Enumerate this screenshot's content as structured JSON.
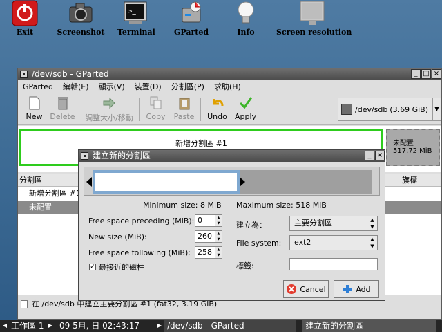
{
  "desktop": {
    "icons": [
      {
        "label": "Exit",
        "icon": "power-icon"
      },
      {
        "label": "Screenshot",
        "icon": "camera-icon"
      },
      {
        "label": "Terminal",
        "icon": "terminal-icon"
      },
      {
        "label": "GParted",
        "icon": "gparted-icon"
      },
      {
        "label": "Info",
        "icon": "lightbulb-icon"
      },
      {
        "label": "Screen resolution",
        "icon": "monitor-icon"
      }
    ]
  },
  "gparted": {
    "title": "/dev/sdb - GParted",
    "menu": [
      "GParted",
      "編輯(E)",
      "顯示(V)",
      "裝置(D)",
      "分割區(P)",
      "求助(H)"
    ],
    "toolbar": {
      "new": "New",
      "delete": "Delete",
      "resize": "調整大小/移動",
      "copy": "Copy",
      "paste": "Paste",
      "undo": "Undo",
      "apply": "Apply"
    },
    "device": {
      "name": "/dev/sdb",
      "size": "(3.69 GiB)"
    },
    "diskmap": {
      "new_partition": "新增分割區 #1",
      "unallocated_label": "未配置",
      "unallocated_size": "517.72 MiB"
    },
    "table": {
      "col_partition": "分割區",
      "col_flags": "旗標",
      "rows": [
        "新增分割區 #1",
        "未配置"
      ]
    },
    "status": "在 /dev/sdb 中建立主要分割區 #1 (fat32, 3.19 GiB)"
  },
  "dialog": {
    "title": "建立新的分割區",
    "min_size": "Minimum size: 8 MiB",
    "max_size": "Maximum size: 518 MiB",
    "free_before_label": "Free space preceding (MiB):",
    "free_before_value": "0",
    "new_size_label": "New size (MiB):",
    "new_size_value": "260",
    "free_after_label": "Free space following (MiB):",
    "free_after_value": "258",
    "create_as_label": "建立為：",
    "create_as_value": "主要分割區",
    "fs_label": "File system:",
    "fs_value": "ext2",
    "label_label": "標籤:",
    "label_value": "",
    "align_label": "最接近的磁柱",
    "align_checked": true,
    "cancel": "Cancel",
    "add": "Add"
  },
  "taskbar": {
    "workspace": "工作區 1",
    "datetime": "09 5月, 日 02:43:17",
    "tasks": [
      "/dev/sdb - GParted",
      "建立新的分割區"
    ]
  }
}
